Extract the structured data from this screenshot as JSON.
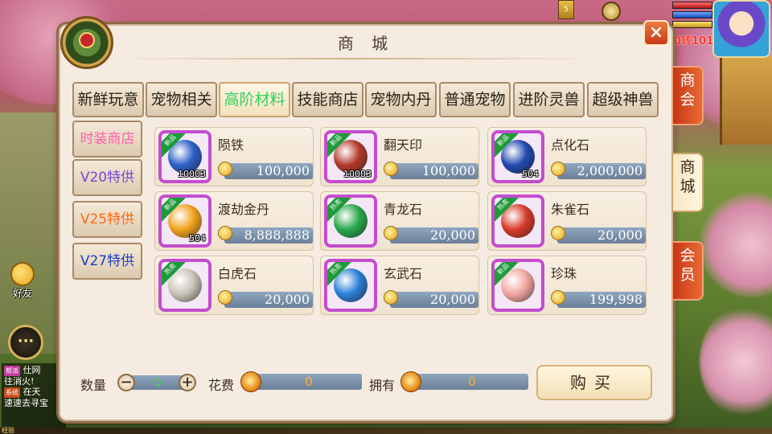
{
  "hud": {
    "top_icon_text": "5",
    "level_text": "0转101"
  },
  "friend_label": "好友",
  "chat_icon": "···",
  "chat_log": [
    {
      "tag": "帮派",
      "text": "仕网"
    },
    {
      "tag": "",
      "text": "往消火!"
    },
    {
      "tag": "系统",
      "text": "在天"
    },
    {
      "tag": "",
      "text": "速速去寻宝"
    }
  ],
  "exp_label": "经验",
  "panel": {
    "title": "商 城",
    "close_icon": "×"
  },
  "tabs": [
    {
      "label": "新鲜玩意",
      "active": false
    },
    {
      "label": "宠物相关",
      "active": false
    },
    {
      "label": "高阶材料",
      "active": true
    },
    {
      "label": "技能商店",
      "active": false
    },
    {
      "label": "宠物内丹",
      "active": false
    },
    {
      "label": "普通宠物",
      "active": false
    },
    {
      "label": "进阶灵兽",
      "active": false
    },
    {
      "label": "超级神兽",
      "active": false
    }
  ],
  "categories": [
    {
      "label": "时装商店",
      "color": "#ff5fae"
    },
    {
      "label": "V20特供",
      "color": "#7a45d8"
    },
    {
      "label": "V25特供",
      "color": "#ff6a1a"
    },
    {
      "label": "V27特供",
      "color": "#1b3fc7"
    }
  ],
  "items": [
    {
      "name": "陨铁",
      "price": "100,000",
      "qty": "10003",
      "ribbon": "新品",
      "art": "#2d5fc8"
    },
    {
      "name": "翻天印",
      "price": "100,000",
      "qty": "10003",
      "ribbon": "新品",
      "art": "#b23a2a"
    },
    {
      "name": "点化石",
      "price": "2,000,000",
      "qty": "504",
      "ribbon": "新品",
      "art": "#2248b0"
    },
    {
      "name": "渡劫金丹",
      "price": "8,888,888",
      "qty": "504",
      "ribbon": "新品",
      "art": "#f0a21e"
    },
    {
      "name": "青龙石",
      "price": "20,000",
      "qty": "",
      "ribbon": "热卖",
      "art": "#2aa84c"
    },
    {
      "name": "朱雀石",
      "price": "20,000",
      "qty": "",
      "ribbon": "热卖",
      "art": "#d83a2a"
    },
    {
      "name": "白虎石",
      "price": "20,000",
      "qty": "",
      "ribbon": "热卖",
      "art": "#c8c4b8"
    },
    {
      "name": "玄武石",
      "price": "20,000",
      "qty": "",
      "ribbon": "热卖",
      "art": "#2b7fd8"
    },
    {
      "name": "珍珠",
      "price": "199,998",
      "qty": "",
      "ribbon": "新品",
      "art": "#f2a6a0"
    }
  ],
  "footer": {
    "quantity_label": "数量",
    "quantity_value": "0",
    "minus": "−",
    "plus": "+",
    "cost_label": "花费",
    "cost_value": "0",
    "own_label": "拥有",
    "own_value": "0",
    "buy_label": "购买"
  },
  "side_tabs": [
    {
      "label": "商会"
    },
    {
      "label": "商城"
    },
    {
      "label": "会员"
    }
  ]
}
